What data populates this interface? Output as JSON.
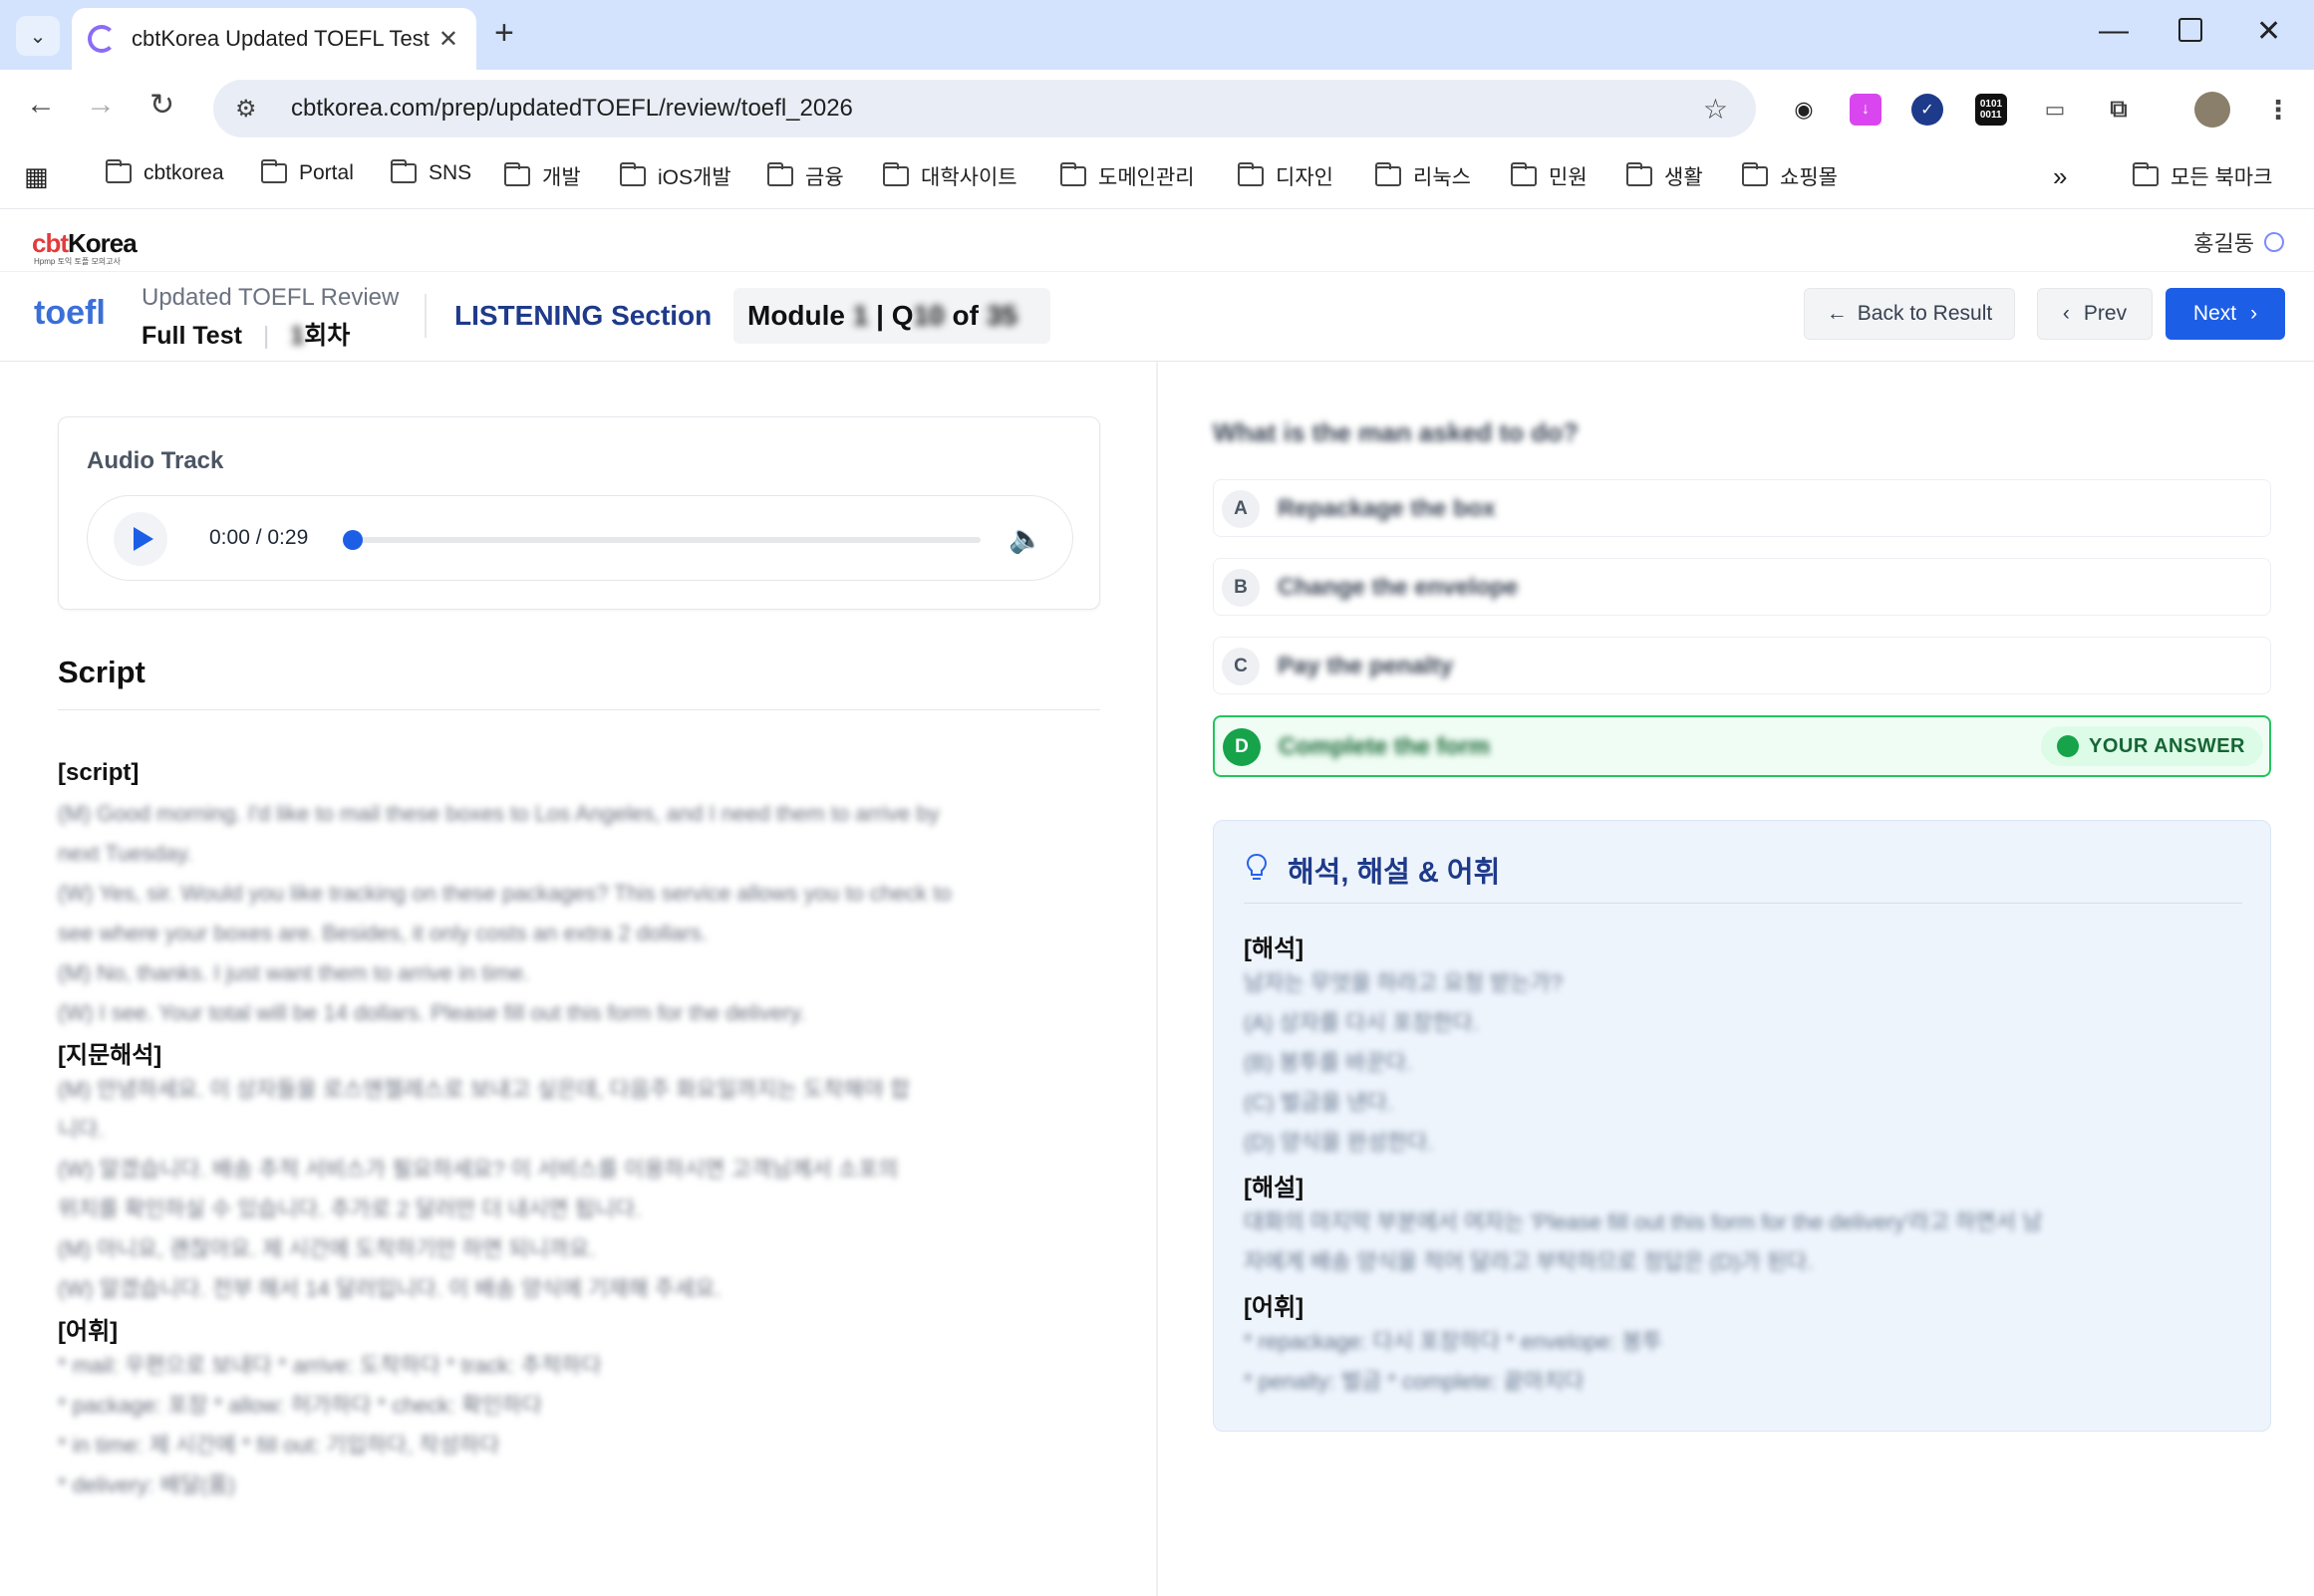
{
  "browser": {
    "tab_title": "cbtKorea Updated TOEFL Test",
    "url": "cbtkorea.com/prep/updatedTOEFL/review/toefl_2026",
    "bookmarks": [
      "cbtkorea",
      "Portal",
      "SNS",
      "개발",
      "iOS개발",
      "금융",
      "대학사이트",
      "도메인관리",
      "디자인",
      "리눅스",
      "민원",
      "생활",
      "쇼핑몰"
    ],
    "all_bookmarks": "모든 북마크",
    "overflow": "»"
  },
  "site": {
    "logo": "cbtKorea",
    "logo_sub": "Hpmp 토익 토플 모의고사",
    "user": "홍길동"
  },
  "header": {
    "toefl_logo": "toefl",
    "title": "Updated TOEFL Review",
    "test_type": "Full Test",
    "round_num": "1",
    "round_suffix": "회차",
    "section": "LISTENING Section",
    "module_label": "Module",
    "module_num": "1",
    "q_label": "| Q",
    "q_num": "10",
    "of_label": "of",
    "total": "35",
    "back": "Back to Result",
    "prev": "Prev",
    "next": "Next"
  },
  "audio": {
    "label": "Audio Track",
    "time": "0:00 / 0:29",
    "progress": 0
  },
  "script": {
    "heading": "Script",
    "script_label": "[script]",
    "script_lines": [
      "(M) Good morning. I'd like to mail these boxes to Los Angeles, and I need them to arrive by",
      "next Tuesday.",
      "(W) Yes, sir. Would you like tracking on these packages? This service allows you to check to",
      "see where your boxes are. Besides, it only costs an extra 2 dollars.",
      "(M) No, thanks. I just want them to arrive in time.",
      "(W) I see. Your total will be 14 dollars. Please fill out this form for the delivery."
    ],
    "translation_label": "[지문해석]",
    "translation_lines": [
      "(M) 안녕하세요. 이 상자들을 로스앤젤레스로 보내고 싶은데, 다음주 화요일까지는 도착해야 합",
      "니다.",
      "(W) 알겠습니다. 배송 추적 서비스가 필요하세요? 이 서비스를 이용하시면 고객님께서 소포의",
      "위치를 확인하실 수 있습니다. 추가로 2 달러만 더 내시면 됩니다.",
      "(M) 아니요, 괜찮아요. 제 시간에 도착하기만 하면 되니까요.",
      "(W) 알겠습니다. 전부 해서 14 달러입니다. 이 배송 양식에 기재해 주세요."
    ],
    "vocab_label": "[어휘]",
    "vocab_lines": [
      "* mail: 우편으로 보내다 * arrive: 도착하다 * track: 추적하다",
      "* package: 포장 * allow: 허가하다 * check: 확인하다",
      "* in time: 제 시간에 * fill out: 기입하다, 작성하다",
      "* delivery: 배달(품)"
    ]
  },
  "question": {
    "text": "What is the man asked to do?",
    "options": [
      {
        "letter": "A",
        "text": "Repackage the box"
      },
      {
        "letter": "B",
        "text": "Change the envelope"
      },
      {
        "letter": "C",
        "text": "Pay the penalty"
      },
      {
        "letter": "D",
        "text": "Complete the form"
      }
    ],
    "your_answer": "YOUR ANSWER"
  },
  "explanation": {
    "title": "해석, 해설 & 어휘",
    "interp_label": "[해석]",
    "interp_lines": [
      "남자는 무엇을 하라고 요청 받는가?",
      "(A) 상자를 다시 포장한다.",
      "(B) 봉투를 바꾼다.",
      "(C) 벌금을 낸다.",
      "(D) 양식을 완성한다."
    ],
    "comment_label": "[해설]",
    "comment_lines": [
      "대화의 마지막 부분에서 여자는 'Please fill out this form for the delivery'라고 하면서 남",
      "자에게 배송 양식을 적어 달라고 부탁하므로 정답은 (D)가 된다."
    ],
    "vocab_label": "[어휘]",
    "vocab_lines": [
      "* repackage: 다시 포장하다 * envelope: 봉투",
      "* penalty: 벌금 * complete: 끝마치다"
    ]
  },
  "colors": {
    "accent": "#1d5ee6",
    "success": "#16a34a",
    "heading": "#1e3a8a"
  }
}
